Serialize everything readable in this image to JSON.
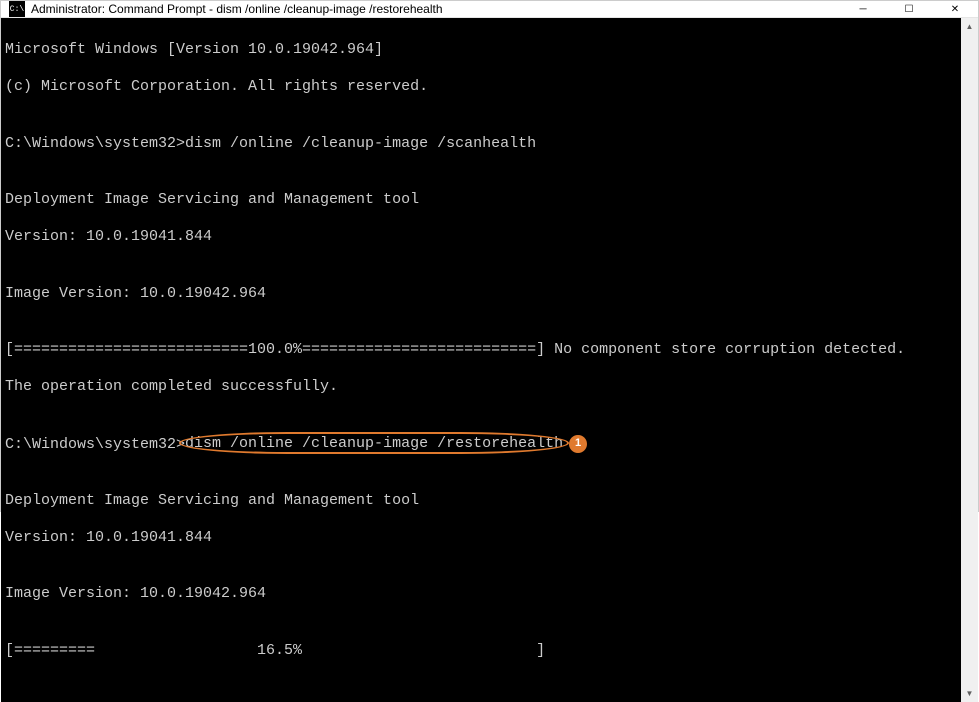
{
  "titlebar": {
    "icon_text": "C:\\",
    "title": "Administrator: Command Prompt - dism  /online /cleanup-image /restorehealth"
  },
  "window_controls": {
    "minimize": "─",
    "maximize": "☐",
    "close": "✕"
  },
  "terminal": {
    "lines": {
      "l0": "Microsoft Windows [Version 10.0.19042.964]",
      "l1": "(c) Microsoft Corporation. All rights reserved.",
      "l2": "",
      "l3_prompt": "C:\\Windows\\system32>",
      "l3_cmd": "dism /online /cleanup-image /scanhealth",
      "l4": "",
      "l5": "Deployment Image Servicing and Management tool",
      "l6": "Version: 10.0.19041.844",
      "l7": "",
      "l8": "Image Version: 10.0.19042.964",
      "l9": "",
      "l10": "[==========================100.0%==========================] No component store corruption detected.",
      "l11": "The operation completed successfully.",
      "l12": "",
      "l13_prompt": "C:\\Windows\\system32>",
      "l13_cmd": "dism /online /cleanup-image /restorehealth",
      "l14": "",
      "l15": "Deployment Image Servicing and Management tool",
      "l16": "Version: 10.0.19041.844",
      "l17": "",
      "l18": "Image Version: 10.0.19042.964",
      "l19": "",
      "l20": "[=========                  16.5%                          ] "
    }
  },
  "callout": {
    "badge_number": "1"
  },
  "scrollbar": {
    "up": "▲",
    "down": "▼"
  }
}
